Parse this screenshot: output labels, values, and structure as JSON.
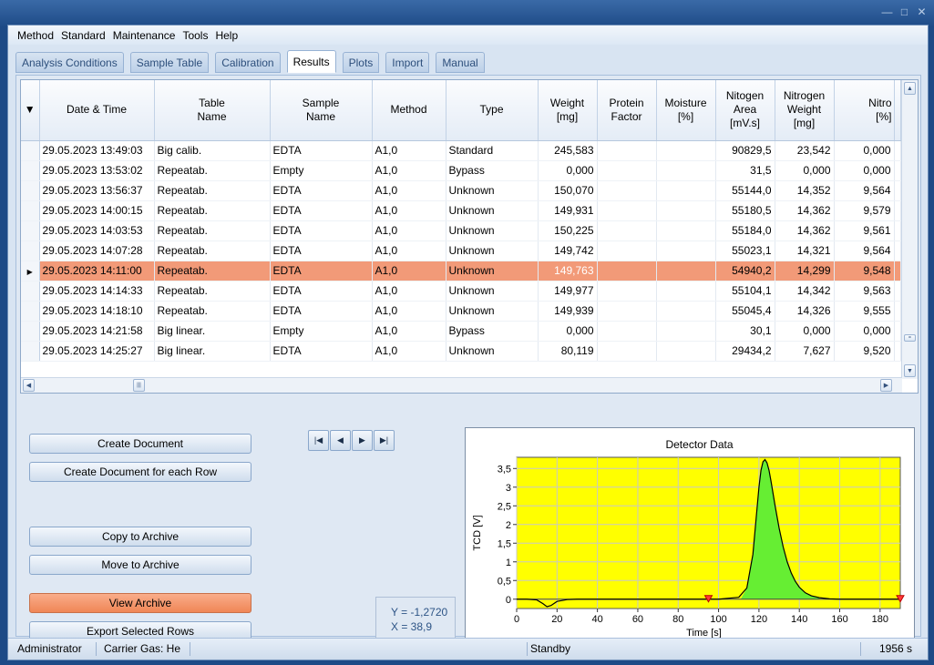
{
  "menu": [
    "Method",
    "Standard",
    "Maintenance",
    "Tools",
    "Help"
  ],
  "tabs": [
    "Analysis Conditions",
    "Sample Table",
    "Calibration",
    "Results",
    "Plots",
    "Import",
    "Manual"
  ],
  "active_tab": "Results",
  "grid": {
    "columns": [
      {
        "l1": "Date & Time",
        "l2": "",
        "l3": ""
      },
      {
        "l1": "Table",
        "l2": "Name",
        "l3": ""
      },
      {
        "l1": "Sample",
        "l2": "Name",
        "l3": ""
      },
      {
        "l1": "Method",
        "l2": "",
        "l3": ""
      },
      {
        "l1": "Type",
        "l2": "",
        "l3": ""
      },
      {
        "l1": "Weight",
        "l2": "[mg]",
        "l3": ""
      },
      {
        "l1": "Protein",
        "l2": "Factor",
        "l3": ""
      },
      {
        "l1": "Moisture",
        "l2": "[%]",
        "l3": ""
      },
      {
        "l1": "Nitogen",
        "l2": "Area",
        "l3": "[mV.s]"
      },
      {
        "l1": "Nitrogen",
        "l2": "Weight",
        "l3": "[mg]"
      },
      {
        "l1": "Nitro",
        "l2": "[%]",
        "l3": ""
      }
    ],
    "rows": [
      [
        "29.05.2023 13:49:03",
        "Big calib.",
        "EDTA",
        "A1,0",
        "Standard",
        "245,583",
        "",
        "",
        "90829,5",
        "23,542",
        "0,000"
      ],
      [
        "29.05.2023 13:53:02",
        "Repeatab.",
        "Empty",
        "A1,0",
        "Bypass",
        "0,000",
        "",
        "",
        "31,5",
        "0,000",
        "0,000"
      ],
      [
        "29.05.2023 13:56:37",
        "Repeatab.",
        "EDTA",
        "A1,0",
        "Unknown",
        "150,070",
        "",
        "",
        "55144,0",
        "14,352",
        "9,564"
      ],
      [
        "29.05.2023 14:00:15",
        "Repeatab.",
        "EDTA",
        "A1,0",
        "Unknown",
        "149,931",
        "",
        "",
        "55180,5",
        "14,362",
        "9,579"
      ],
      [
        "29.05.2023 14:03:53",
        "Repeatab.",
        "EDTA",
        "A1,0",
        "Unknown",
        "150,225",
        "",
        "",
        "55184,0",
        "14,362",
        "9,561"
      ],
      [
        "29.05.2023 14:07:28",
        "Repeatab.",
        "EDTA",
        "A1,0",
        "Unknown",
        "149,742",
        "",
        "",
        "55023,1",
        "14,321",
        "9,564"
      ],
      [
        "29.05.2023 14:11:00",
        "Repeatab.",
        "EDTA",
        "A1,0",
        "Unknown",
        "149,763",
        "",
        "",
        "54940,2",
        "14,299",
        "9,548"
      ],
      [
        "29.05.2023 14:14:33",
        "Repeatab.",
        "EDTA",
        "A1,0",
        "Unknown",
        "149,977",
        "",
        "",
        "55104,1",
        "14,342",
        "9,563"
      ],
      [
        "29.05.2023 14:18:10",
        "Repeatab.",
        "EDTA",
        "A1,0",
        "Unknown",
        "149,939",
        "",
        "",
        "55045,4",
        "14,326",
        "9,555"
      ],
      [
        "29.05.2023 14:21:58",
        "Big linear.",
        "Empty",
        "A1,0",
        "Bypass",
        "0,000",
        "",
        "",
        "30,1",
        "0,000",
        "0,000"
      ],
      [
        "29.05.2023 14:25:27",
        "Big linear.",
        "EDTA",
        "A1,0",
        "Unknown",
        "80,119",
        "",
        "",
        "29434,2",
        "7,627",
        "9,520"
      ]
    ],
    "selected_row": 6
  },
  "buttons": {
    "create_document": "Create Document",
    "create_document_each_row": "Create Document for each Row",
    "copy_to_archive": "Copy to Archive",
    "move_to_archive": "Move to Archive",
    "view_archive": "View Archive",
    "export_selected_rows": "Export Selected Rows"
  },
  "coords": {
    "y": "Y = -1,2720",
    "x": "X = 38,9"
  },
  "chart_data": {
    "type": "line",
    "title": "Detector Data",
    "xlabel": "Time [s]",
    "ylabel": "TCD [V]",
    "xlim": [
      0,
      190
    ],
    "ylim": [
      -0.25,
      3.8
    ],
    "xticks": [
      0,
      20,
      40,
      60,
      80,
      100,
      120,
      140,
      160,
      180
    ],
    "yticks": [
      0,
      0.5,
      1,
      1.5,
      2,
      2.5,
      3,
      3.5
    ],
    "ytick_labels": [
      "0",
      "0,5",
      "1",
      "1,5",
      "2",
      "2,5",
      "3",
      "3,5"
    ],
    "grid": true,
    "background": "#ffff00",
    "peak_fill": "#66ee33",
    "series": [
      {
        "x": [
          0,
          5,
          10,
          13,
          15,
          17,
          20,
          25,
          30,
          60,
          100,
          110,
          114,
          117,
          119,
          120,
          121,
          122,
          123,
          124,
          125,
          126,
          128,
          130,
          132,
          134,
          136,
          138,
          140,
          143,
          146,
          150,
          155,
          160,
          170,
          190
        ],
        "y": [
          0,
          0,
          -0.02,
          -0.12,
          -0.2,
          -0.17,
          -0.06,
          -0.01,
          0,
          0,
          0,
          0.05,
          0.3,
          1.2,
          2.4,
          3.0,
          3.45,
          3.68,
          3.74,
          3.65,
          3.45,
          3.15,
          2.5,
          1.9,
          1.4,
          1.0,
          0.7,
          0.48,
          0.32,
          0.17,
          0.09,
          0.04,
          0.01,
          0,
          0,
          0
        ]
      }
    ],
    "markers_x": [
      95,
      190
    ],
    "peak_range": [
      111,
      150
    ]
  },
  "status": {
    "user": "Administrator",
    "gas": "Carrier Gas: He",
    "state": "Standby",
    "time": "1956 s"
  }
}
